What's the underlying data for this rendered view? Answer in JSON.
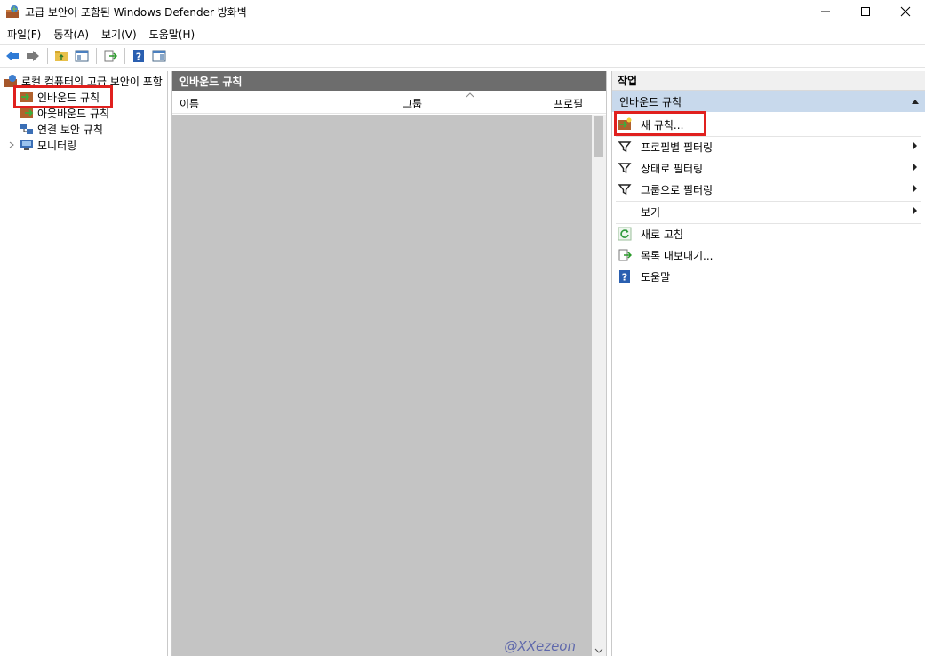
{
  "window": {
    "title": "고급 보안이 포함된 Windows Defender 방화벽"
  },
  "menubar": {
    "items": [
      "파일(F)",
      "동작(A)",
      "보기(V)",
      "도움말(H)"
    ]
  },
  "tree": {
    "root": "로컬 컴퓨터의 고급 보안이 포함",
    "items": [
      "인바운드 규칙",
      "아웃바운드 규칙",
      "연결 보안 규칙",
      "모니터링"
    ]
  },
  "main": {
    "header": "인바운드 규칙",
    "columns": [
      "이름",
      "그룹",
      "프로필"
    ],
    "watermark_1": "@XXezeon",
    "watermark_2": "@XXezeon"
  },
  "actions": {
    "header": "작업",
    "section": "인바운드 규칙",
    "items": [
      "새 규칙...",
      "프로필별 필터링",
      "상태로 필터링",
      "그룹으로 필터링",
      "보기",
      "새로 고침",
      "목록 내보내기...",
      "도움말"
    ]
  },
  "colors": {
    "highlight": "#e0201e",
    "pane_header": "#6d6d6d",
    "section_bg": "#c8d9ec"
  }
}
